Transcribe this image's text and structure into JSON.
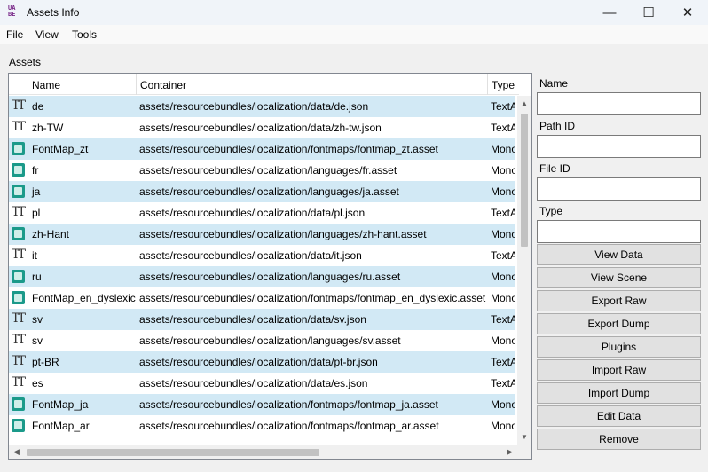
{
  "window": {
    "app_icon_lines": [
      "UA",
      "BE"
    ],
    "title": "Assets Info",
    "minimize_glyph": "—",
    "maximize_glyph": "☐",
    "close_glyph": "✕"
  },
  "menu": [
    "File",
    "View",
    "Tools"
  ],
  "assets_group_label": "Assets",
  "columns": [
    "Name",
    "Container",
    "Type"
  ],
  "rows": [
    {
      "icon": "text-asset-icon",
      "name": "de",
      "container": "assets/resourcebundles/localization/data/de.json",
      "type": "TextA",
      "selected": true
    },
    {
      "icon": "text-asset-icon",
      "name": "zh-TW",
      "container": "assets/resourcebundles/localization/data/zh-tw.json",
      "type": "TextA",
      "selected": false
    },
    {
      "icon": "monobehaviour-icon",
      "name": "FontMap_zt",
      "container": "assets/resourcebundles/localization/fontmaps/fontmap_zt.asset",
      "type": "Mono",
      "selected": true
    },
    {
      "icon": "monobehaviour-icon",
      "name": "fr",
      "container": "assets/resourcebundles/localization/languages/fr.asset",
      "type": "Mono",
      "selected": false
    },
    {
      "icon": "monobehaviour-icon",
      "name": "ja",
      "container": "assets/resourcebundles/localization/languages/ja.asset",
      "type": "Mono",
      "selected": true
    },
    {
      "icon": "text-asset-icon",
      "name": "pl",
      "container": "assets/resourcebundles/localization/data/pl.json",
      "type": "TextA",
      "selected": false
    },
    {
      "icon": "monobehaviour-icon",
      "name": "zh-Hant",
      "container": "assets/resourcebundles/localization/languages/zh-hant.asset",
      "type": "Mono",
      "selected": true
    },
    {
      "icon": "text-asset-icon",
      "name": "it",
      "container": "assets/resourcebundles/localization/data/it.json",
      "type": "TextA",
      "selected": false
    },
    {
      "icon": "monobehaviour-icon",
      "name": "ru",
      "container": "assets/resourcebundles/localization/languages/ru.asset",
      "type": "Mono",
      "selected": true
    },
    {
      "icon": "monobehaviour-icon",
      "name": "FontMap_en_dyslexic",
      "container": "assets/resourcebundles/localization/fontmaps/fontmap_en_dyslexic.asset",
      "type": "Mono",
      "selected": false
    },
    {
      "icon": "text-asset-icon",
      "name": "sv",
      "container": "assets/resourcebundles/localization/data/sv.json",
      "type": "TextA",
      "selected": true
    },
    {
      "icon": "text-asset-icon",
      "name": "sv",
      "container": "assets/resourcebundles/localization/languages/sv.asset",
      "type": "Mono",
      "selected": false
    },
    {
      "icon": "text-asset-icon",
      "name": "pt-BR",
      "container": "assets/resourcebundles/localization/data/pt-br.json",
      "type": "TextA",
      "selected": true
    },
    {
      "icon": "text-asset-icon",
      "name": "es",
      "container": "assets/resourcebundles/localization/data/es.json",
      "type": "TextA",
      "selected": false
    },
    {
      "icon": "monobehaviour-icon",
      "name": "FontMap_ja",
      "container": "assets/resourcebundles/localization/fontmaps/fontmap_ja.asset",
      "type": "Mono",
      "selected": true
    },
    {
      "icon": "monobehaviour-icon",
      "name": "FontMap_ar",
      "container": "assets/resourcebundles/localization/fontmaps/fontmap_ar.asset",
      "type": "Mono",
      "selected": false
    }
  ],
  "fields": [
    {
      "label": "Name",
      "value": ""
    },
    {
      "label": "Path ID",
      "value": ""
    },
    {
      "label": "File ID",
      "value": ""
    },
    {
      "label": "Type",
      "value": ""
    }
  ],
  "buttons": [
    "View Data",
    "View Scene",
    "Export Raw",
    "Export Dump",
    "Plugins",
    "Import Raw",
    "Import Dump",
    "Edit Data",
    "Remove"
  ],
  "colors": {
    "selected_row": "#d2e9f5",
    "monobehaviour_icon": "#1b9a8a"
  }
}
